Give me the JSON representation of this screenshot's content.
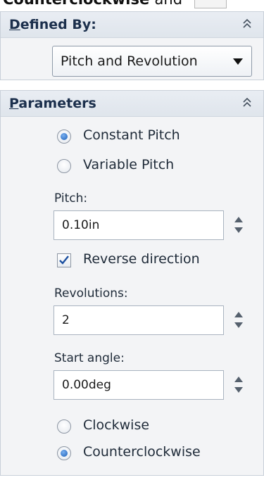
{
  "top_fragment": {
    "text_bold": "Counterclockwise",
    "text_plain": "and"
  },
  "defined_by": {
    "title_accel": "D",
    "title_rest": "efined By:",
    "dropdown_value": "Pitch and Revolution"
  },
  "parameters": {
    "title_accel": "P",
    "title_rest": "arameters",
    "pitch_mode": {
      "options": [
        "Constant Pitch",
        "Variable Pitch"
      ],
      "selected": "Constant Pitch"
    },
    "pitch": {
      "label": "Pitch:",
      "value": "0.10in"
    },
    "reverse_direction": {
      "label": "Reverse direction",
      "checked": true
    },
    "revolutions": {
      "label": "Revolutions:",
      "value": "2"
    },
    "start_angle": {
      "label": "Start angle:",
      "value": "0.00deg"
    },
    "direction": {
      "options": [
        "Clockwise",
        "Counterclockwise"
      ],
      "selected": "Counterclockwise"
    }
  },
  "colors": {
    "panel_bg": "#f3f4f6",
    "header_title": "#1b2f4c",
    "radio_selected": "#1b5fb8"
  }
}
